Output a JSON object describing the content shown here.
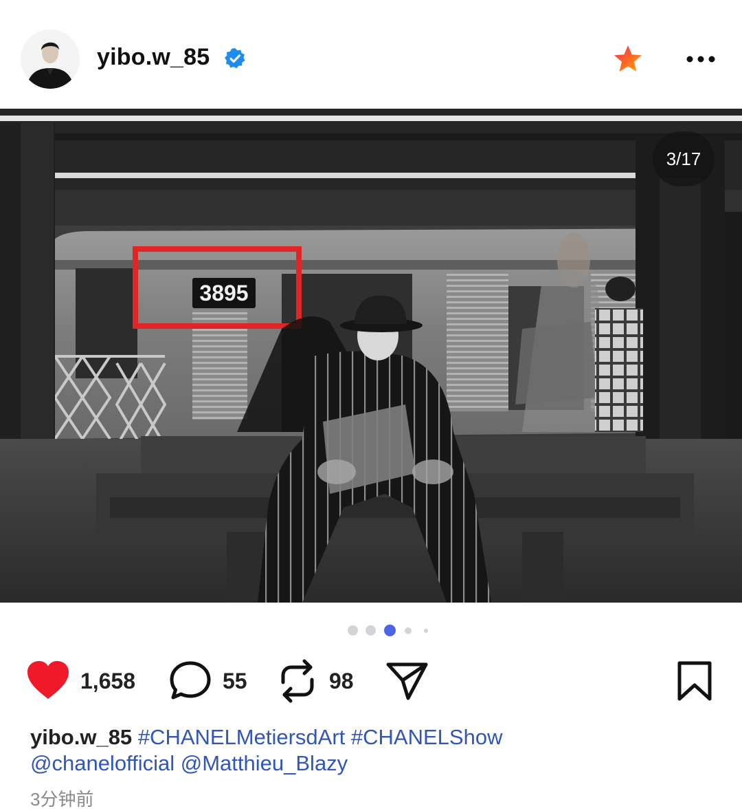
{
  "post": {
    "username": "yibo.w_85",
    "image_counter": "3/17",
    "train_number": "3895",
    "carousel": {
      "count": 5,
      "active_index": 2
    },
    "likes": "1,658",
    "comments": "55",
    "reposts": "98",
    "caption": {
      "username": "yibo.w_85",
      "hashtags": [
        "#CHANELMetiersdArt",
        "#CHANELShow"
      ],
      "mentions": [
        "@chanelofficial",
        "@Matthieu_Blazy"
      ]
    },
    "timestamp": "3分钟前"
  },
  "colors": {
    "like": "#f0192a",
    "verified": "#1d8cf0",
    "link": "#2f56b8",
    "highlight_box": "#e02525",
    "dot_active": "#4f63e6",
    "dot_inactive": "#d4d4d8"
  },
  "icons": {
    "verified": "verified-badge-icon",
    "star": "star-icon",
    "more": "more-dots-icon",
    "like": "heart-icon",
    "comment": "comment-bubble-icon",
    "repost": "repost-icon",
    "share": "send-icon",
    "save": "bookmark-icon"
  }
}
